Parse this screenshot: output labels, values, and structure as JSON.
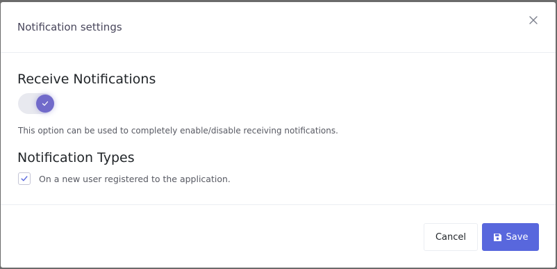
{
  "dialog": {
    "title": "Notification settings"
  },
  "receive": {
    "heading": "Receive Notifications",
    "toggle_on": true,
    "help_text": "This option can be used to completely enable/disable receiving notifications."
  },
  "types": {
    "heading": "Notification Types",
    "items": [
      {
        "label": "On a new user registered to the application.",
        "checked": true
      }
    ]
  },
  "footer": {
    "cancel_label": "Cancel",
    "save_label": "Save"
  },
  "colors": {
    "accent": "#716aca",
    "primary_button": "#5867dd"
  },
  "icons": {
    "close": "close-icon",
    "toggle_check": "check-icon",
    "checkbox_check": "check-icon",
    "save": "floppy-disk-icon"
  }
}
